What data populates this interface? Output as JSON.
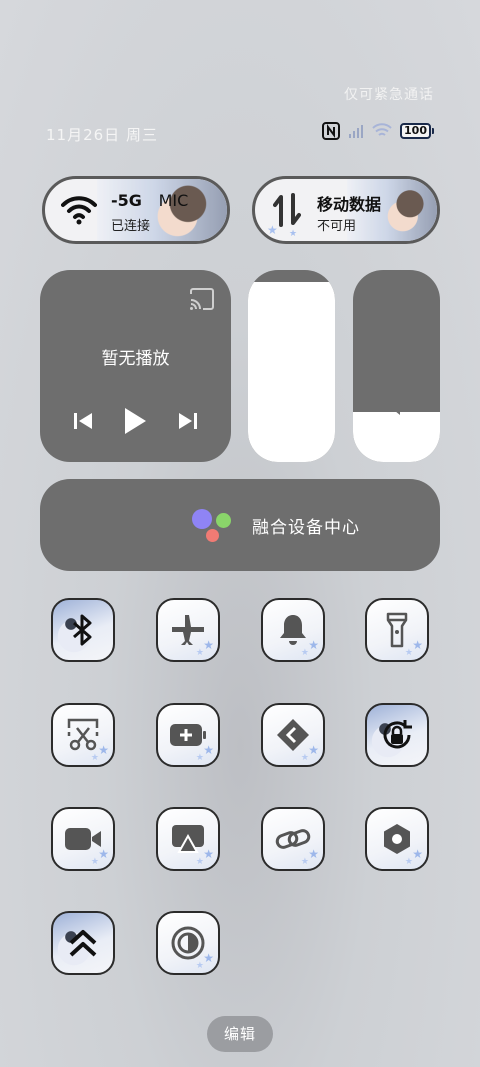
{
  "status_bar": {
    "emergency_text": "仅可紧急通话",
    "date": "11月26日 周三",
    "battery": "100"
  },
  "wifi_tile": {
    "name": "-5G",
    "name_extra": "MIC",
    "status": "已连接"
  },
  "mobile_tile": {
    "name": "移动数据",
    "status": "不可用"
  },
  "media": {
    "title": "暂无播放"
  },
  "sliders": {
    "brightness_level": 0.94,
    "volume_level": 0.26
  },
  "fusion": {
    "label": "融合设备中心"
  },
  "quick_tiles": [
    "bluetooth-icon",
    "airplane-icon",
    "bell-icon",
    "flashlight-icon",
    "screenshot-icon",
    "battery-saver-icon",
    "vpn-icon",
    "rotation-lock-icon",
    "screen-record-icon",
    "cast-icon",
    "link-icon",
    "settings-icon",
    "game-mode-icon",
    "dark-mode-icon"
  ],
  "edit_label": "编辑"
}
